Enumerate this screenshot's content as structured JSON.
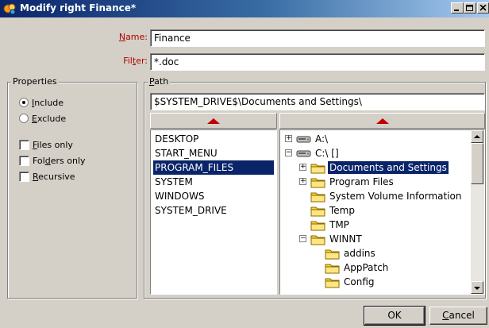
{
  "window": {
    "title": "Modify right Finance*",
    "min_glyph": "_",
    "max_glyph": "□",
    "close_glyph": "×"
  },
  "form": {
    "name_label_prefix": "",
    "name_label_key": "N",
    "name_label_rest": "ame:",
    "name_value": "Finance",
    "filter_label_prefix": "Fil",
    "filter_label_key": "t",
    "filter_label_rest": "er:",
    "filter_value": "*.doc"
  },
  "properties": {
    "title": "Properties",
    "include_key": "I",
    "include_rest": "nclude",
    "include_selected": true,
    "exclude_prefix": "",
    "exclude_key": "E",
    "exclude_rest": "xclude",
    "files_only_key": "F",
    "files_only_rest": "iles only",
    "folders_only_prefix": "Fol",
    "folders_only_key": "d",
    "folders_only_rest": "ers only",
    "recursive_key": "R",
    "recursive_rest": "ecursive"
  },
  "path": {
    "title_key": "P",
    "title_rest": "ath",
    "value": "$SYSTEM_DRIVE$\\Documents and Settings\\"
  },
  "variables": {
    "items": [
      "DESKTOP",
      "START_MENU",
      "PROGRAM_FILES",
      "SYSTEM",
      "WINDOWS",
      "SYSTEM_DRIVE"
    ],
    "selected_index": 2
  },
  "tree": {
    "rows": [
      {
        "label": "A:\\",
        "icon": "drive-icon",
        "expander": "+",
        "level": 0
      },
      {
        "label": "C:\\ []",
        "icon": "drive-icon",
        "expander": "−",
        "level": 0
      },
      {
        "label": "Documents and Settings",
        "icon": "folder-icon",
        "expander": "+",
        "level": 1,
        "selected": true
      },
      {
        "label": "Program Files",
        "icon": "folder-icon",
        "expander": "+",
        "level": 1
      },
      {
        "label": "System Volume Information",
        "icon": "folder-icon",
        "expander": "",
        "level": 1
      },
      {
        "label": "Temp",
        "icon": "folder-icon",
        "expander": "",
        "level": 1
      },
      {
        "label": "TMP",
        "icon": "folder-icon",
        "expander": "",
        "level": 1
      },
      {
        "label": "WINNT",
        "icon": "folder-icon",
        "expander": "−",
        "level": 1
      },
      {
        "label": "addins",
        "icon": "folder-icon",
        "expander": "",
        "level": 2
      },
      {
        "label": "AppPatch",
        "icon": "folder-icon",
        "expander": "",
        "level": 2
      },
      {
        "label": "Config",
        "icon": "folder-icon",
        "expander": "",
        "level": 2
      }
    ]
  },
  "buttons": {
    "ok": "OK",
    "cancel_key": "C",
    "cancel_rest": "ancel"
  },
  "colors": {
    "accent_red": "#c00000",
    "label_red": "#b00000",
    "selection": "#0a246a",
    "folder": "#f5d33b"
  }
}
